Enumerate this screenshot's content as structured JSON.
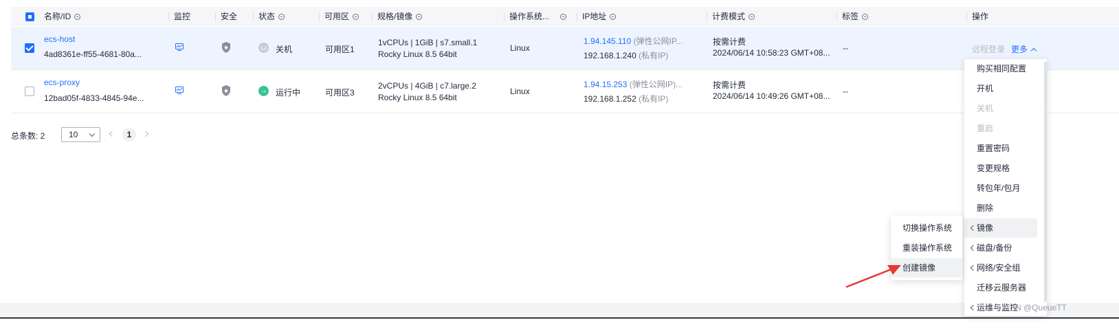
{
  "headers": {
    "name": "名称/ID",
    "monitor": "监控",
    "security": "安全",
    "status": "状态",
    "az": "可用区",
    "spec": "规格/镜像",
    "os": "操作系统...",
    "ip": "IP地址",
    "billing": "计费模式",
    "tag": "标签",
    "action": "操作"
  },
  "rows": [
    {
      "name": "ecs-host",
      "id": "4ad8361e-ff55-4681-80a...",
      "status": "关机",
      "az": "可用区1",
      "spec": "1vCPUs | 1GiB | s7.small.1",
      "image": "Rocky Linux 8.5 64bit",
      "os": "Linux",
      "public_ip": "1.94.145.110",
      "public_ip_note": "(弹性公网IP...",
      "private_ip": "192.168.1.240",
      "private_ip_note": "(私有IP)",
      "billing": "按需计费",
      "created": "2024/06/14 10:58:23 GMT+08...",
      "tag": "--",
      "action_remote": "远程登录",
      "action_more": "更多"
    },
    {
      "name": "ecs-proxy",
      "id": "12bad05f-4833-4845-94e...",
      "status": "运行中",
      "az": "可用区3",
      "spec": "2vCPUs | 4GiB | c7.large.2",
      "image": "Rocky Linux 8.5 64bit",
      "os": "Linux",
      "public_ip": "1.94.15.253",
      "public_ip_note": "(弹性公网IP)...",
      "private_ip": "192.168.1.252",
      "private_ip_note": "(私有IP)",
      "billing": "按需计费",
      "created": "2024/06/14 10:49:26 GMT+08...",
      "tag": "--"
    }
  ],
  "pagination": {
    "total_label": "总条数: 2",
    "page_size": "10",
    "current_page": "1"
  },
  "more_menu": [
    "购买相同配置",
    "开机",
    "关机",
    "重启",
    "重置密码",
    "变更规格",
    "转包年/包月",
    "删除",
    "镜像",
    "磁盘/备份",
    "网络/安全组",
    "迁移云服务器",
    "运维与监控"
  ],
  "image_submenu": [
    "切换操作系统",
    "重装操作系统",
    "创建镜像"
  ],
  "watermark": "N @QueueTT",
  "colors": {
    "accent": "#1e6fff",
    "running": "#3ac295",
    "arrow": "#e53935"
  }
}
